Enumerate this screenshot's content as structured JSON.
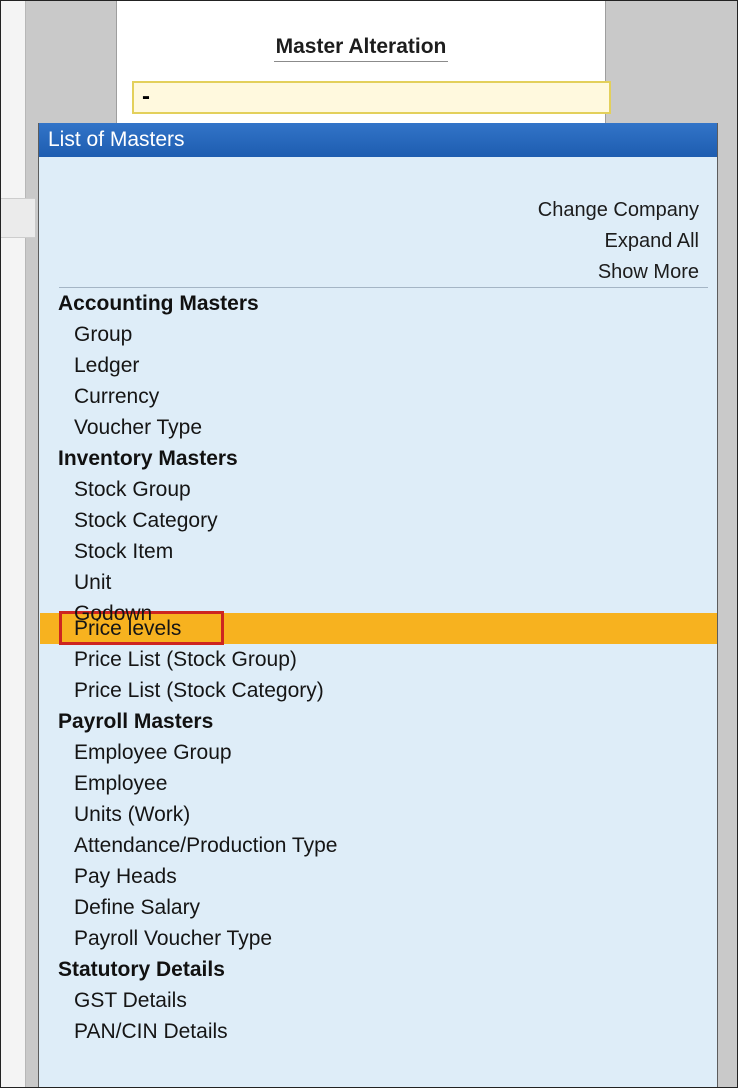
{
  "master_alteration": {
    "title": "Master Alteration",
    "input_value": "-"
  },
  "list": {
    "title": "List of Masters",
    "actions": {
      "change_company": "Change Company",
      "expand_all": "Expand All",
      "show_more": "Show More"
    },
    "sections": [
      {
        "label": "Accounting Masters",
        "items": [
          "Group",
          "Ledger",
          "Currency",
          "Voucher Type"
        ]
      },
      {
        "label": "Inventory Masters",
        "items": [
          "Stock Group",
          "Stock Category",
          "Stock Item",
          "Unit",
          "Godown",
          "Price levels",
          "Price List (Stock Group)",
          "Price List (Stock Category)"
        ]
      },
      {
        "label": "Payroll Masters",
        "items": [
          "Employee Group",
          "Employee",
          "Units (Work)",
          "Attendance/Production Type",
          "Pay Heads",
          "Define Salary",
          "Payroll Voucher Type"
        ]
      },
      {
        "label": "Statutory Details",
        "items": [
          "GST Details",
          "PAN/CIN Details"
        ]
      }
    ]
  }
}
